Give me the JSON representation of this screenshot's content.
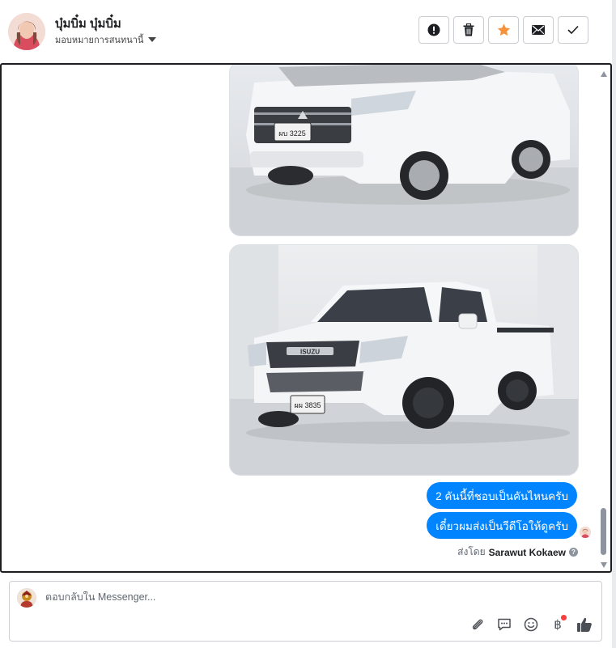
{
  "contact": {
    "name": "บุ๋มบิ๋ม บุ๋มบิ๋ม",
    "assign_label": "มอบหมายการสนทนานี้"
  },
  "header_actions": [
    {
      "icon": "alert-icon",
      "label": "mark-spam"
    },
    {
      "icon": "trash-icon",
      "label": "delete"
    },
    {
      "icon": "star-icon",
      "label": "star"
    },
    {
      "icon": "envelope-icon",
      "label": "mark-unread"
    },
    {
      "icon": "check-icon",
      "label": "mark-done"
    }
  ],
  "messages": [
    {
      "type": "image",
      "subject": "white Mitsubishi Triton pickup",
      "plate": "ผบ 3225"
    },
    {
      "type": "image",
      "subject": "white Isuzu D-Max pickup",
      "brand": "ISUZU",
      "plate": "ผผ 3835"
    },
    {
      "type": "text",
      "text": "2 คันนี้ที่ชอบเป็นคันไหนครับ"
    },
    {
      "type": "text",
      "text": "เดี๋ยวผมส่งเป็นวีดีโอให้ดูครับ"
    }
  ],
  "sent_by": {
    "prefix": "ส่งโดย",
    "name": "Sarawut Kokaew",
    "help_glyph": "?"
  },
  "composer": {
    "placeholder": "ตอบกลับใน Messenger...",
    "tools": [
      "paperclip-icon",
      "saved-reply-icon",
      "emoji-icon",
      "baht-icon",
      "thumbs-up-icon"
    ],
    "baht_symbol": "฿"
  },
  "colors": {
    "bubble": "#0084ff",
    "star": "#f7923a",
    "notification_dot": "#fa3e3e",
    "panel_border": "#1c1e21"
  }
}
